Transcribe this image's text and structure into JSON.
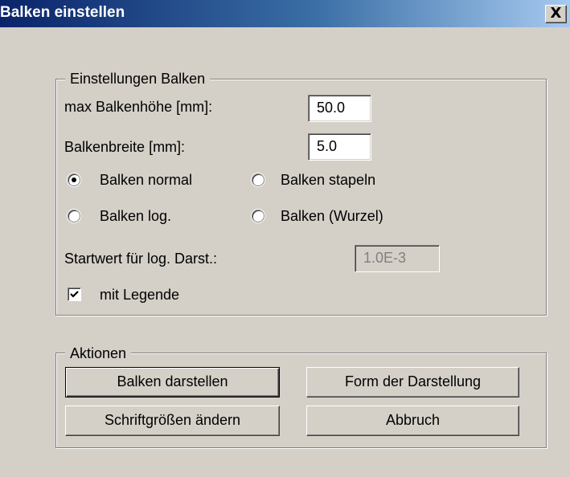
{
  "window": {
    "title": "Balken einstellen",
    "close_label": "X"
  },
  "settings_group": {
    "legend": "Einstellungen Balken",
    "max_height_label": "max Balkenhöhe [mm]:",
    "max_height_value": "50.0",
    "width_label": "Balkenbreite  [mm]:",
    "width_value": "5.0",
    "radios": [
      {
        "label": "Balken  normal",
        "checked": true
      },
      {
        "label": "Balken  stapeln",
        "checked": false
      },
      {
        "label": "Balken log.",
        "checked": false
      },
      {
        "label": "Balken (Wurzel)",
        "checked": false
      }
    ],
    "start_value_label": "Startwert für log. Darst.:",
    "start_value": "1.0E-3",
    "legend_checkbox_label": "mit Legende",
    "legend_checkbox_checked": true
  },
  "actions_group": {
    "legend": "Aktionen",
    "show_bars_button": "Balken  darstellen",
    "form_button": "Form der Darstellung",
    "font_size_button": "Schriftgrößen ändern",
    "cancel_button": "Abbruch"
  }
}
